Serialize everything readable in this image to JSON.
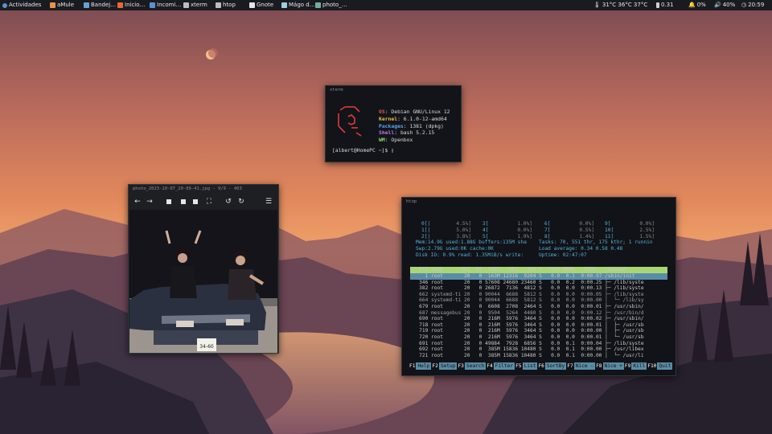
{
  "panel": {
    "activities": "Actividades",
    "taskbar": [
      {
        "icon": "amule-icon",
        "label": "aMule"
      },
      {
        "icon": "mail-icon",
        "label": "Bandej…"
      },
      {
        "icon": "firefox-icon",
        "label": "Inicio…"
      },
      {
        "icon": "folder-icon",
        "label": "Incomi…"
      },
      {
        "icon": "terminal-icon",
        "label": "xterm"
      },
      {
        "icon": "terminal-icon",
        "label": "htop"
      },
      {
        "icon": "gnote-icon",
        "label": "Gnote"
      },
      {
        "icon": "wizard-icon",
        "label": "Mágo d…"
      },
      {
        "icon": "image-icon",
        "label": "photo_…"
      }
    ],
    "tray": {
      "temps": "31°C 36°C 37°C",
      "load": "0.31",
      "volume": "0%",
      "battery": "40%",
      "clock": "20:59"
    }
  },
  "xterm": {
    "title": "xterm",
    "info": [
      {
        "key": "OS",
        "value": "Debian GNU/Linux 12",
        "color": "#e05a5a"
      },
      {
        "key": "Kernel",
        "value": "6.1.0-12-amd64",
        "color": "#e8c04a"
      },
      {
        "key": "Packages",
        "value": "1381 (dpkg)",
        "color": "#58a8e8"
      },
      {
        "key": "Shell",
        "value": "bash 5.2.15",
        "color": "#c878e0"
      },
      {
        "key": "WM",
        "value": "Openbox",
        "color": "#8ed860"
      }
    ],
    "prompt": "[albert@HomePC ~]$ ▯"
  },
  "viewer": {
    "title": "photo_2023-10-07_20-09-41.jpg - 9/9 - 403",
    "plate": "34-60"
  },
  "htop": {
    "title": "htop",
    "cpus": [
      {
        "label": "0[|",
        "pct": "4.5%]"
      },
      {
        "label": "1[|",
        "pct": "5.0%]"
      },
      {
        "label": "2[|",
        "pct": "3.8%]"
      },
      {
        "label": "3[",
        "pct": "1.0%]"
      },
      {
        "label": "4[",
        "pct": "0.0%]"
      },
      {
        "label": "5[",
        "pct": "1.9%]"
      },
      {
        "label": "6[",
        "pct": "0.0%]"
      },
      {
        "label": "7[",
        "pct": "0.5%]"
      },
      {
        "label": "8[",
        "pct": "1.4%]"
      },
      {
        "label": "9[",
        "pct": "0.0%]"
      },
      {
        "label": "10[",
        "pct": "2.5%]"
      },
      {
        "label": "11[",
        "pct": "1.5%]"
      }
    ],
    "mem": "Mem:14.9G used:1.88G buffers:135M sha",
    "swp": "Swp:2.79G used:0K cache:0K",
    "disk": "Disk IO: 0.9% read: 1.35MiB/s write:",
    "tasks": "Tasks: 70, 551 thr, 175 kthr; 1 runnin",
    "loadavg": "Load average: 0.34 0.58 0.48",
    "uptime": "Uptime: 02:47:07",
    "header": "   PID USER      PRI  NI  VIRT   RES   SHR S  CPU% MEM%   TIME+  Command",
    "rows": [
      "     1 root       20   0  163M 12316  9204 S   0.0  0.1  0:00.97 /sbin/init",
      "   346 root       20   0 57608 24680 23460 S   0.0  0.2  0:00.25 ├─ /lib/syste",
      "   382 root       20   0 26872  7136  4812 S   0.0  0.0  0:00.13 ├─ /lib/syste",
      "   662 systemd-ti 20   0 90044  6688  5812 S   0.0  0.0  0:00.05 ├─ /lib/syste",
      "   664 systemd-ti 20   0 90044  6688  5812 S   0.0  0.0  0:00.00 │  └─ /lib/sy",
      "   679 root       20   0  6608  2708  2464 S   0.0  0.0  0:00.01 ├─ /usr/sbin/",
      "   687 messagebus 20   0  9504  5264  4480 S   0.0  0.0  0:00.12 ├─ /usr/bin/d",
      "   690 root       20   0  216M  5976  3464 S   0.0  0.0  0:00.02 ├─ /usr/sbin/",
      "   718 root       20   0  216M  5976  3464 S   0.0  0.0  0:00.01 │  ├─ /usr/sb",
      "   719 root       20   0  216M  5976  3464 S   0.0  0.0  0:00.00 │  ├─ /usr/sb",
      "   720 root       20   0  216M  5976  3464 S   0.0  0.0  0:00.01 │  └─ /usr/sb",
      "   691 root       20   0 49884  7928  6856 S   0.0  0.1  0:00.04 ├─ /lib/syste",
      "   692 root       20   0  385M 15836 10480 S   0.0  0.1  0:00.00 ├─ /usr/libex",
      "   721 root       20   0  385M 15836 10480 S   0.0  0.1  0:00.00 │  └─ /usr/li"
    ],
    "fkeys": [
      {
        "n": "F1",
        "l": "Help"
      },
      {
        "n": "F2",
        "l": "Setup"
      },
      {
        "n": "F3",
        "l": "Search"
      },
      {
        "n": "F4",
        "l": "Filter"
      },
      {
        "n": "F5",
        "l": "List"
      },
      {
        "n": "F6",
        "l": "SortBy"
      },
      {
        "n": "F7",
        "l": "Nice -"
      },
      {
        "n": "F8",
        "l": "Nice +"
      },
      {
        "n": "F9",
        "l": "Kill"
      },
      {
        "n": "F10",
        "l": "Quit"
      }
    ]
  }
}
